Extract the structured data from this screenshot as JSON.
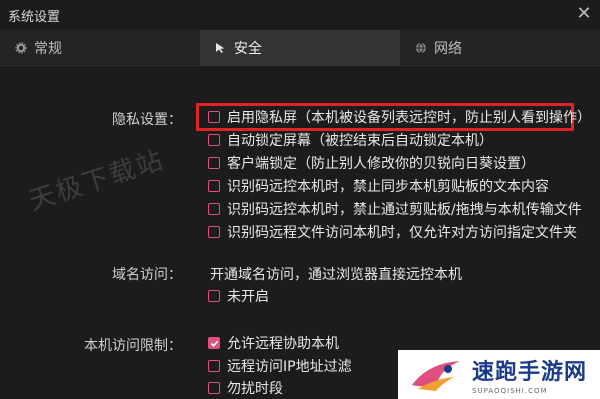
{
  "window": {
    "title": "系统设置"
  },
  "tabs": [
    {
      "label": "常规",
      "icon": "gear-icon"
    },
    {
      "label": "安全",
      "icon": "cursor-icon"
    },
    {
      "label": "网络",
      "icon": "globe-icon"
    }
  ],
  "privacy": {
    "label": "隐私设置：",
    "items": [
      {
        "text": "启用隐私屏（本机被设备列表远控时，防止别人看到操作）",
        "checked": false
      },
      {
        "text": "自动锁定屏幕（被控结束后自动锁定本机）",
        "checked": false
      },
      {
        "text": "客户端锁定（防止别人修改你的贝锐向日葵设置）",
        "checked": false
      },
      {
        "text": "识别码远控本机时，禁止同步本机剪贴板的文本内容",
        "checked": false
      },
      {
        "text": "识别码远控本机时，禁止通过剪贴板/拖拽与本机传输文件",
        "checked": false
      },
      {
        "text": "识别码远程文件访问本机时，仅允许对方访问指定文件夹",
        "checked": false
      }
    ]
  },
  "domain": {
    "label": "域名访问：",
    "description": "开通域名访问，通过浏览器直接远控本机",
    "items": [
      {
        "text": "未开启",
        "checked": false
      }
    ]
  },
  "access": {
    "label": "本机访问限制：",
    "items": [
      {
        "text": "允许远程协助本机",
        "checked": true
      },
      {
        "text": "远程访问IP地址过滤",
        "checked": false
      },
      {
        "text": "勿扰时段",
        "checked": false
      }
    ]
  },
  "watermark": {
    "text": "天极下载站"
  },
  "logo": {
    "text": "速跑手游网",
    "subtext": "SUPAOQISHI.COM"
  },
  "colors": {
    "accent": "#e0507e",
    "highlight": "#e02424",
    "background": "#1c1c1c",
    "logo_blue": "#1a3b8c"
  }
}
